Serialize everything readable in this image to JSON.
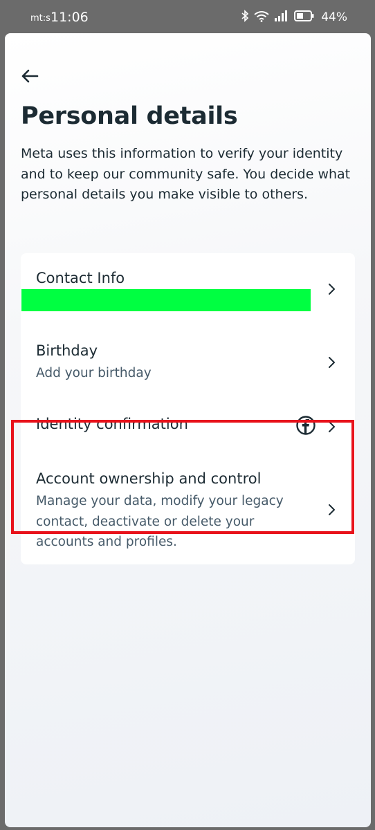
{
  "status_bar": {
    "carrier": "mt:s",
    "time": "11:06",
    "battery": "44%",
    "icons": [
      "bluetooth-icon",
      "wifi-icon",
      "signal-icon",
      "battery-icon"
    ]
  },
  "header": {
    "back_icon": "arrow-left-icon",
    "title": "Personal details",
    "description": "Meta uses this information to verify your identity and to keep our community safe. You decide what personal details you make visible to others."
  },
  "list": {
    "contact": {
      "title": "Contact Info",
      "value_redacted": true
    },
    "birthday": {
      "title": "Birthday",
      "subtitle": "Add your birthday"
    },
    "identity": {
      "title": "Identity confirmation",
      "icon": "facebook-icon"
    },
    "account": {
      "title": "Account ownership and control",
      "subtitle": "Manage your data, modify your legacy contact, deactivate or delete your accounts and profiles.",
      "highlighted": true
    }
  },
  "colors": {
    "text_primary": "#1c2b33",
    "text_secondary": "#465a69",
    "highlight": "#e8121b",
    "redaction": "#00ff41"
  }
}
